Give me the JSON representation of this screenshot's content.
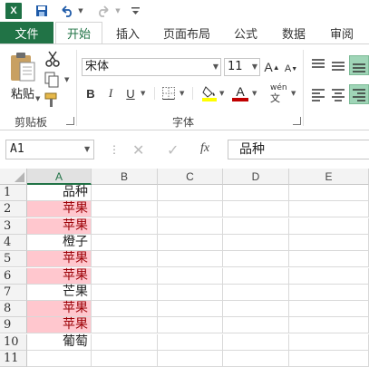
{
  "qat": {
    "app_logo": "X",
    "icons": [
      "excel-logo-icon",
      "save-icon",
      "undo-icon",
      "undo-dropdown-icon",
      "redo-icon",
      "redo-dropdown-icon",
      "customize-qat-icon"
    ]
  },
  "tabs": [
    {
      "label": "文件",
      "state": "file"
    },
    {
      "label": "开始",
      "state": "active"
    },
    {
      "label": "插入",
      "state": ""
    },
    {
      "label": "页面布局",
      "state": ""
    },
    {
      "label": "公式",
      "state": ""
    },
    {
      "label": "数据",
      "state": ""
    },
    {
      "label": "审阅",
      "state": ""
    }
  ],
  "ribbon": {
    "clipboard": {
      "paste_label": "粘贴",
      "group_label": "剪贴板"
    },
    "font": {
      "font_name": "宋体",
      "font_size": "11",
      "bold": "B",
      "italic": "I",
      "underline": "U",
      "grow_font": "A",
      "shrink_font": "A",
      "font_color_letter": "A",
      "phonetic": "wén",
      "group_label": "字体"
    }
  },
  "formula_bar": {
    "name_box": "A1",
    "fx_label": "fx",
    "content": "品种"
  },
  "grid": {
    "columns": [
      "A",
      "B",
      "C",
      "D",
      "E"
    ],
    "selected_column": "A",
    "rows": [
      {
        "row": "1",
        "a": "品种",
        "highlight": false
      },
      {
        "row": "2",
        "a": "苹果",
        "highlight": true
      },
      {
        "row": "3",
        "a": "苹果",
        "highlight": true
      },
      {
        "row": "4",
        "a": "橙子",
        "highlight": false
      },
      {
        "row": "5",
        "a": "苹果",
        "highlight": true
      },
      {
        "row": "6",
        "a": "苹果",
        "highlight": true
      },
      {
        "row": "7",
        "a": "芒果",
        "highlight": false
      },
      {
        "row": "8",
        "a": "苹果",
        "highlight": true
      },
      {
        "row": "9",
        "a": "苹果",
        "highlight": true
      },
      {
        "row": "10",
        "a": "葡萄",
        "highlight": false
      },
      {
        "row": "11",
        "a": "",
        "highlight": false
      }
    ]
  },
  "colors": {
    "accent": "#217346",
    "highlight_fill": "#ffc7ce",
    "highlight_text": "#9c0006",
    "fill_swatch": "#ffff00",
    "font_swatch": "#c00000"
  }
}
